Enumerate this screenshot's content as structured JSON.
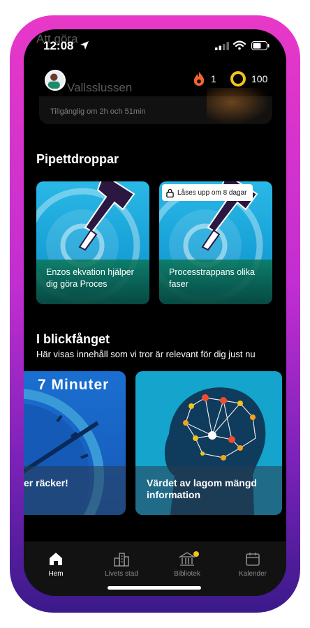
{
  "status_bar": {
    "time": "12:08"
  },
  "background_ghost": {
    "title": "Att göra",
    "subtitle": "Vallsslussen",
    "availability": "Tillgänglig om 2h och 51min"
  },
  "header": {
    "streak_count": "1",
    "coin_count": "100"
  },
  "pipettdroppar": {
    "title": "Pipettdroppar",
    "cards": [
      {
        "label": "Enzos ekvation hjälper dig göra Proces",
        "locked": false
      },
      {
        "label": "Processtrappans olika faser",
        "locked": true,
        "lock_text": "Låses upp om 8 dagar"
      }
    ]
  },
  "spotlight": {
    "title": "I blickfånget",
    "subtitle": "Här visas innehåll som vi tror är relevant för dig just nu",
    "cards": [
      {
        "banner": "7 Minuter",
        "label": "er räcker!"
      },
      {
        "label": "Värdet av lagom mängd information"
      }
    ]
  },
  "nav": {
    "items": [
      {
        "label": "Hem",
        "icon": "home-icon",
        "active": true
      },
      {
        "label": "Livets stad",
        "icon": "city-icon",
        "active": false
      },
      {
        "label": "Bibliotek",
        "icon": "library-icon",
        "active": false,
        "badge": true
      },
      {
        "label": "Kalender",
        "icon": "calendar-icon",
        "active": false
      }
    ]
  },
  "colors": {
    "frame_top": "#e838c8",
    "frame_bottom": "#3a1a8a",
    "streak": "#f26430",
    "coin": "#f2c318",
    "card_blue": "#18a2d8",
    "badge_dot": "#f2c318"
  }
}
